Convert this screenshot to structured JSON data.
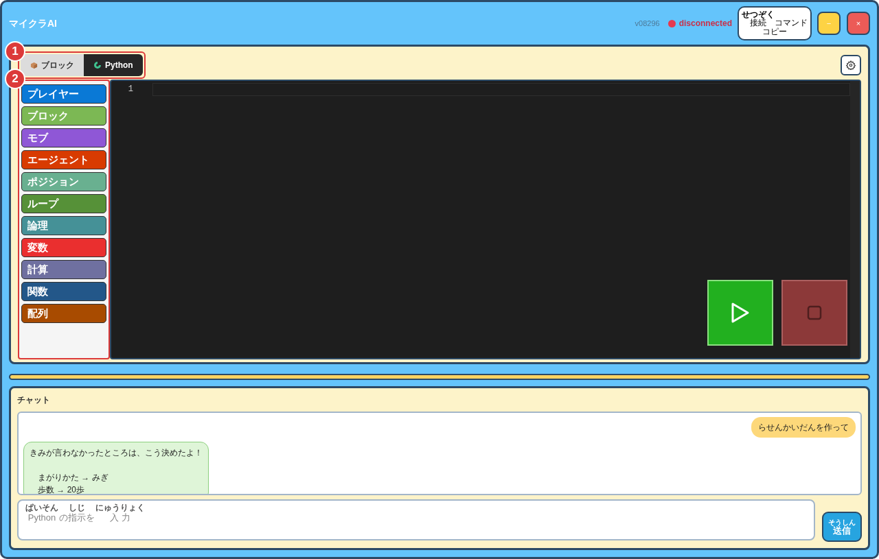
{
  "window": {
    "title": "マイクラAI",
    "version": "v08296",
    "connection": {
      "label": "disconnected",
      "connected": false
    },
    "copy_button": {
      "ruby": "せつぞく",
      "ruby_base": "接続",
      "rest": "コマンド",
      "line2": "コピー"
    },
    "controls": [
      {
        "kind": "minimize",
        "label": "−"
      },
      {
        "kind": "close",
        "label": "×"
      }
    ]
  },
  "annotations": [
    {
      "label": "1"
    },
    {
      "label": "2"
    }
  ],
  "tabs": [
    {
      "label": "ブロック",
      "kind": "block",
      "selected": false
    },
    {
      "label": "Python",
      "kind": "python",
      "selected": true
    }
  ],
  "categories": [
    {
      "label": "プレイヤー",
      "color": "#0a79d6"
    },
    {
      "label": "ブロック",
      "color": "#7cb854"
    },
    {
      "label": "モブ",
      "color": "#8f57d6"
    },
    {
      "label": "エージェント",
      "color": "#d83b01"
    },
    {
      "label": "ポジション",
      "color": "#69b090"
    },
    {
      "label": "ループ",
      "color": "#569138"
    },
    {
      "label": "論理",
      "color": "#459197"
    },
    {
      "label": "変数",
      "color": "#ea2f2f"
    },
    {
      "label": "計算",
      "color": "#6f70a0"
    },
    {
      "label": "関数",
      "color": "#235789"
    },
    {
      "label": "配列",
      "color": "#a84b00"
    }
  ],
  "editor": {
    "line_numbers": [
      "1"
    ]
  },
  "run_controls": [
    {
      "kind": "run",
      "disabled": false
    },
    {
      "kind": "stop",
      "disabled": true
    }
  ],
  "chat": {
    "title": "チャット",
    "messages": [
      {
        "kind": "user",
        "text": "らせんかいだんを作って"
      },
      {
        "kind": "assistant",
        "text": "きみが言わなかったところは、こう決めたよ！",
        "details": [
          "まがりかた → みぎ",
          "歩数 → 20歩"
        ]
      }
    ],
    "placeholder_segments": [
      {
        "text": "Python",
        "ruby": "ぱいそん"
      },
      {
        "text": "の"
      },
      {
        "text": "指示",
        "ruby": "しじ"
      },
      {
        "text": "を"
      },
      {
        "text": "入 力",
        "ruby": "にゅうりょく"
      }
    ],
    "send_button": {
      "ruby": "そうしん",
      "label": "送信"
    }
  }
}
